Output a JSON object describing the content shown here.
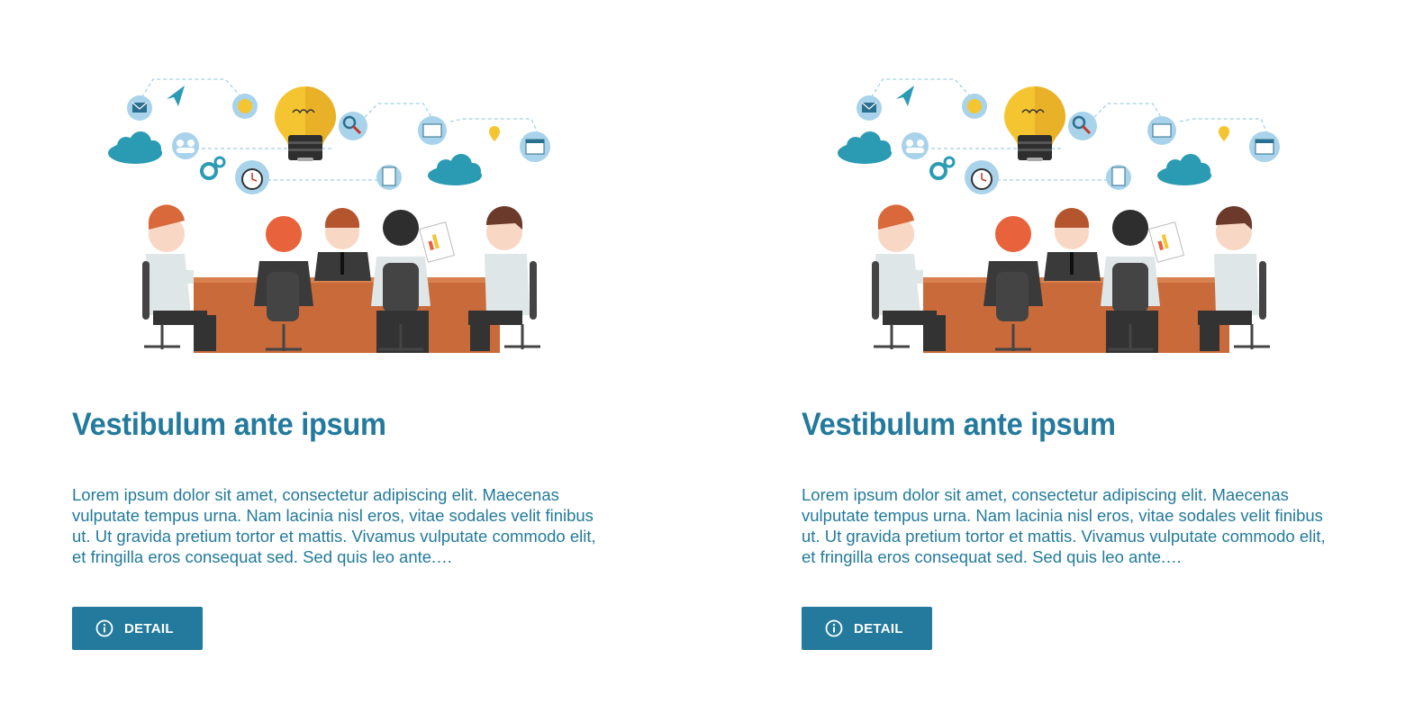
{
  "cards": [
    {
      "illustration": "team-meeting-illustration",
      "title": "Vestibulum ante ipsum",
      "description": "Lorem ipsum dolor sit amet, consectetur adipiscing elit. Maecenas vulputate tempus urna. Nam lacinia nisl eros, vitae sodales velit finibus ut. Ut gravida pretium tortor et mattis. Vivamus vulputate commodo elit, et fringilla eros consequat sed. Sed quis leo ante.…",
      "button_label": "DETAIL",
      "button_icon": "info-icon"
    },
    {
      "illustration": "team-meeting-illustration",
      "title": "Vestibulum ante ipsum",
      "description": "Lorem ipsum dolor sit amet, consectetur adipiscing elit. Maecenas vulputate tempus urna. Nam lacinia nisl eros, vitae sodales velit finibus ut. Ut gravida pretium tortor et mattis. Vivamus vulputate commodo elit, et fringilla eros consequat sed. Sed quis leo ante.…",
      "button_label": "DETAIL",
      "button_icon": "info-icon"
    }
  ],
  "colors": {
    "accent": "#237a9c",
    "table": "#c96a3a",
    "bulb": "#f5c531",
    "cloud": "#2b9bb4",
    "icon_circle": "#a9d3ea"
  }
}
